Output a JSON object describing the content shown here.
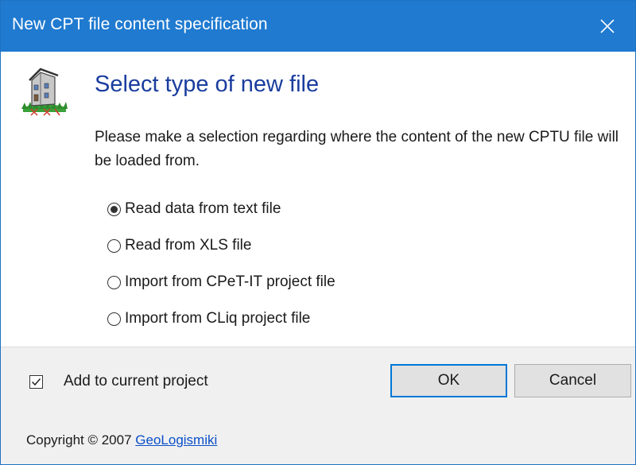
{
  "window": {
    "title": "New CPT file content specification"
  },
  "dialog": {
    "heading": "Select type of new file",
    "description": "Please make a selection regarding where the content of the new CPTU file will be loaded from."
  },
  "options": [
    {
      "label": "Read data from text file",
      "checked": true
    },
    {
      "label": "Read from XLS file",
      "checked": false
    },
    {
      "label": "Import from CPeT-IT project file",
      "checked": false
    },
    {
      "label": "Import from CLiq project file",
      "checked": false
    }
  ],
  "checkbox": {
    "label": "Add to current project",
    "checked": true
  },
  "buttons": {
    "ok": "OK",
    "cancel": "Cancel"
  },
  "footer": {
    "copyright": "Copyright © 2007",
    "link": "GeoLogismiki"
  },
  "colors": {
    "titlebar": "#1f7ad0",
    "heading": "#1a3d9e",
    "link": "#0b4fc9",
    "ok_border": "#0078d7"
  },
  "icons": {
    "app": "house-on-grass-icon",
    "close": "close-icon"
  }
}
